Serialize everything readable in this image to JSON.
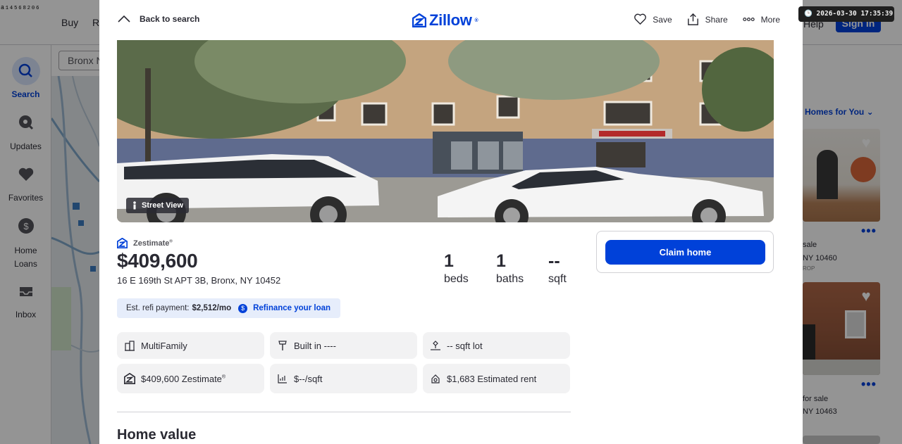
{
  "background": {
    "top_left_text": "ₐ₁₄₅₆₈₂₀₆",
    "nav": [
      "Buy",
      "Re"
    ],
    "help": "Help",
    "signin": "Sign in",
    "search_value": "Bronx N",
    "sidebar": [
      {
        "label": "Search",
        "icon": "search-icon",
        "active": true
      },
      {
        "label": "Updates",
        "icon": "bell-icon",
        "active": false
      },
      {
        "label": "Favorites",
        "icon": "heart-icon",
        "active": false
      },
      {
        "label": "Home Loans",
        "icon": "dollar-icon",
        "active": false
      },
      {
        "label": "Inbox",
        "icon": "inbox-icon",
        "active": false
      }
    ],
    "results_header": "Homes for You",
    "result_cards": [
      {
        "line1": "sale",
        "line2": "NY 10460",
        "tag": "ROP"
      },
      {
        "line1": "for sale",
        "line2": "NY 10463",
        "tag": ""
      }
    ]
  },
  "timestamp": "🕒 2026-03-30 17:35:39",
  "header": {
    "back_label": "Back to search",
    "logo_text": "Zillow",
    "actions": [
      {
        "label": "Save",
        "icon": "heart-outline-icon"
      },
      {
        "label": "Share",
        "icon": "share-icon"
      },
      {
        "label": "More",
        "icon": "more-dots-icon"
      }
    ]
  },
  "photo": {
    "street_view_label": "Street View"
  },
  "listing": {
    "zestimate_label": "Zestimate",
    "zestimate_mark": "®",
    "price": "$409,600",
    "address": "16 E 169th St APT 3B, Bronx, NY 10452",
    "stats": [
      {
        "value": "1",
        "label": "beds"
      },
      {
        "value": "1",
        "label": "baths"
      },
      {
        "value": "--",
        "label": "sqft"
      }
    ],
    "refi": {
      "prefix": "Est. refi payment:",
      "amount": "$2,512/mo",
      "link": "Refinance your loan"
    },
    "facts": [
      {
        "text": "MultiFamily",
        "icon": "building-icon"
      },
      {
        "text": "Built in ----",
        "icon": "hammer-icon"
      },
      {
        "text": "-- sqft lot",
        "icon": "lot-icon"
      },
      {
        "text": "$409,600 Zestimate",
        "icon": "zestimate-icon"
      },
      {
        "text": "$--/sqft",
        "icon": "price-per-sqft-icon"
      },
      {
        "text": "$1,683 Estimated rent",
        "icon": "rent-icon"
      }
    ],
    "home_value_heading": "Home value"
  },
  "claim": {
    "button_label": "Claim home"
  },
  "colors": {
    "brand": "#0041d9",
    "text": "#2a2a33",
    "chip_bg": "#f2f2f3",
    "refi_bg": "#e6edfb"
  }
}
